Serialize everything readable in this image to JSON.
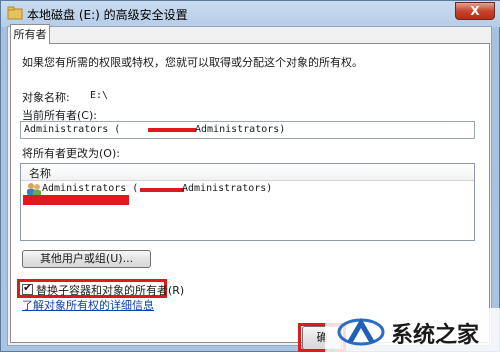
{
  "window": {
    "title": "本地磁盘 (E:) 的高级安全设置",
    "close_label": "X"
  },
  "tab": {
    "label": "所有者"
  },
  "panel": {
    "intro": "如果您有所需的权限或特权，您就可以取得或分配这个对象的所有权。",
    "object_name_label": "对象名称:",
    "object_name_value": "E:\\",
    "current_owner_label": "当前所有者(C):",
    "current_owner_prefix": "Administrators (",
    "current_owner_suffix": "Administrators)",
    "change_owner_label": "将所有者更改为(O):",
    "list_column_name": "名称",
    "list_item_prefix": "Administrators (",
    "list_item_suffix": "Administrators)",
    "other_users_button": "其他用户或组(U)...",
    "replace_checkbox_label": "替换子容器和对象的所有者(R)",
    "replace_checked": true,
    "learn_more_link": "了解对象所有权的详细信息",
    "ok_button": "确"
  },
  "watermark": {
    "text": "系统之家"
  },
  "colors": {
    "redaction": "#e0191f",
    "highlight": "#e0191f",
    "link": "#0645ad",
    "title_bg": "#b9d1ea"
  },
  "icons": [
    "folder-icon",
    "users-icon",
    "watermark-logo-icon"
  ]
}
